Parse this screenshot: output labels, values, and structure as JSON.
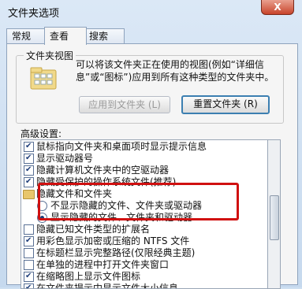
{
  "window": {
    "title": "文件夹选项",
    "close_label": "X"
  },
  "tabs": [
    {
      "label": "常规"
    },
    {
      "label": "查看"
    },
    {
      "label": "搜索"
    }
  ],
  "folder_views": {
    "group_label": "文件夹视图",
    "description": "可以将该文件夹正在使用的视图(例如“详细信息”或“图标”)应用到所有这种类型的文件夹中。",
    "apply_button": "应用到文件夹 (L)",
    "reset_button": "重置文件夹 (R)"
  },
  "advanced": {
    "label": "高级设置:",
    "items": [
      {
        "text": "鼠标指向文件夹和桌面项时显示提示信息",
        "checked": true
      },
      {
        "text": "显示驱动器号",
        "checked": true
      },
      {
        "text": "隐藏计算机文件夹中的空驱动器",
        "checked": true
      },
      {
        "text": "隐藏受保护的操作系统文件(推荐)",
        "checked": true
      },
      {
        "text": "隐藏文件和文件夹",
        "type": "folder"
      },
      {
        "text": "不显示隐藏的文件、文件夹或驱动器",
        "type": "radio",
        "selected": false
      },
      {
        "text": "显示隐藏的文件、文件夹和驱动器",
        "type": "radio",
        "selected": true
      },
      {
        "text": "隐藏已知文件类型的扩展名",
        "checked": false
      },
      {
        "text": "用彩色显示加密或压缩的 NTFS 文件",
        "checked": true
      },
      {
        "text": "在标题栏显示完整路径(仅限经典主题)",
        "checked": false
      },
      {
        "text": "在单独的进程中打开文件夹窗口",
        "checked": false
      },
      {
        "text": "在缩略图上显示文件图标",
        "checked": true
      },
      {
        "text": "在文件夹提示中显示文件大小信息",
        "checked": true
      }
    ]
  }
}
